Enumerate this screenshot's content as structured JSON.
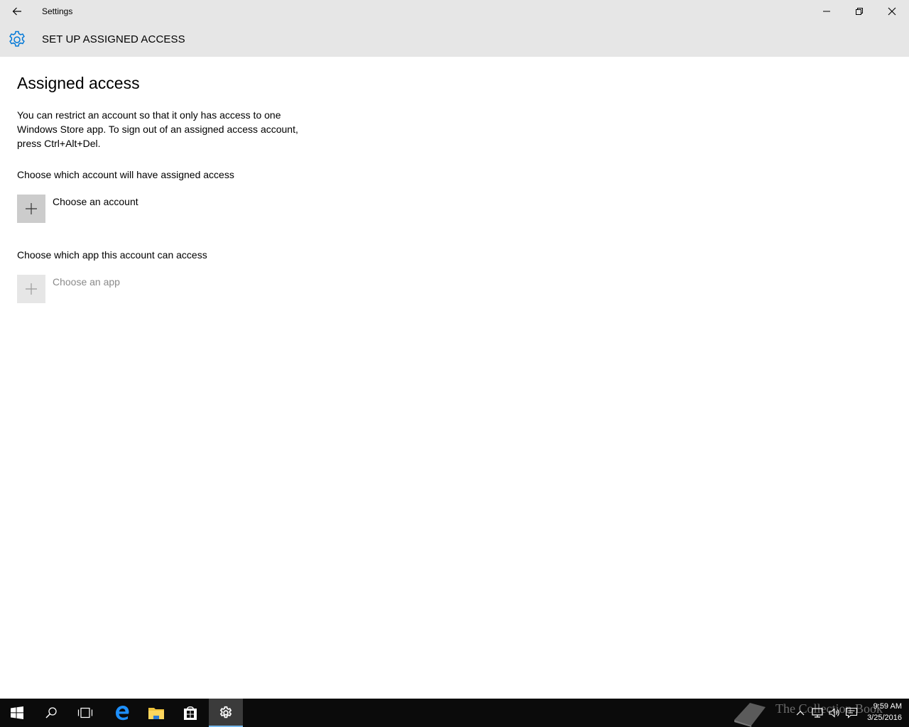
{
  "window": {
    "title": "Settings"
  },
  "header": {
    "title": "SET UP ASSIGNED ACCESS"
  },
  "main": {
    "page_title": "Assigned access",
    "description": "You can restrict an account so that it only has access to one Windows Store app. To sign out of an assigned access account, press Ctrl+Alt+Del.",
    "account_label": "Choose which account will have assigned access",
    "account_picker": "Choose an account",
    "app_label": "Choose which app this account can access",
    "app_picker": "Choose an app"
  },
  "taskbar": {
    "items": [
      "start",
      "search",
      "task-view",
      "edge",
      "file-explorer",
      "store",
      "settings"
    ],
    "active": "settings",
    "clock_time": "9:59 AM",
    "clock_date": "3/25/2016",
    "watermark": "The Collection Book"
  },
  "colors": {
    "titlebar": "#e6e6e6",
    "accent": "#0078d7",
    "taskbar": "#0b0b0b"
  }
}
